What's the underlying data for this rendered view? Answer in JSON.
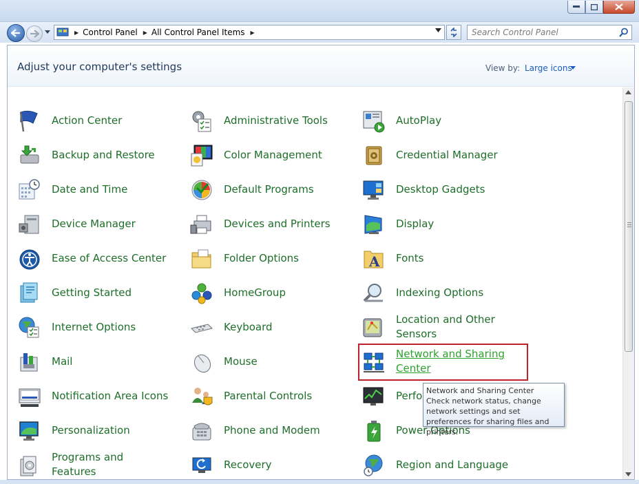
{
  "address": {
    "crumbs": [
      "Control Panel",
      "All Control Panel Items"
    ]
  },
  "search": {
    "placeholder": "Search Control Panel"
  },
  "header": {
    "title": "Adjust your computer's settings",
    "view_by_label": "View by:",
    "view_by_value": "Large icons"
  },
  "items": {
    "col1": [
      "Action Center",
      "Backup and Restore",
      "Date and Time",
      "Device Manager",
      "Ease of Access Center",
      "Getting Started",
      "Internet Options",
      "Mail",
      "Notification Area Icons",
      "Personalization",
      "Programs and Features"
    ],
    "col2": [
      "Administrative Tools",
      "Color Management",
      "Default Programs",
      "Devices and Printers",
      "Folder Options",
      "HomeGroup",
      "Keyboard",
      "Mouse",
      "Parental Controls",
      "Phone and Modem",
      "Recovery"
    ],
    "col3": [
      "AutoPlay",
      "Credential Manager",
      "Desktop Gadgets",
      "Display",
      "Fonts",
      "Indexing Options",
      "Location and Other Sensors",
      "Network and Sharing Center",
      "Perfor and To",
      "Power Options",
      "Region and Language"
    ]
  },
  "tooltip": {
    "title": "Network and Sharing Center",
    "body": "Check network status, change network settings and set preferences for sharing files and printers."
  },
  "colors": {
    "link_green": "#1e6e2a",
    "highlight_red": "#c0202a",
    "accent_blue": "#1a5cbf"
  }
}
